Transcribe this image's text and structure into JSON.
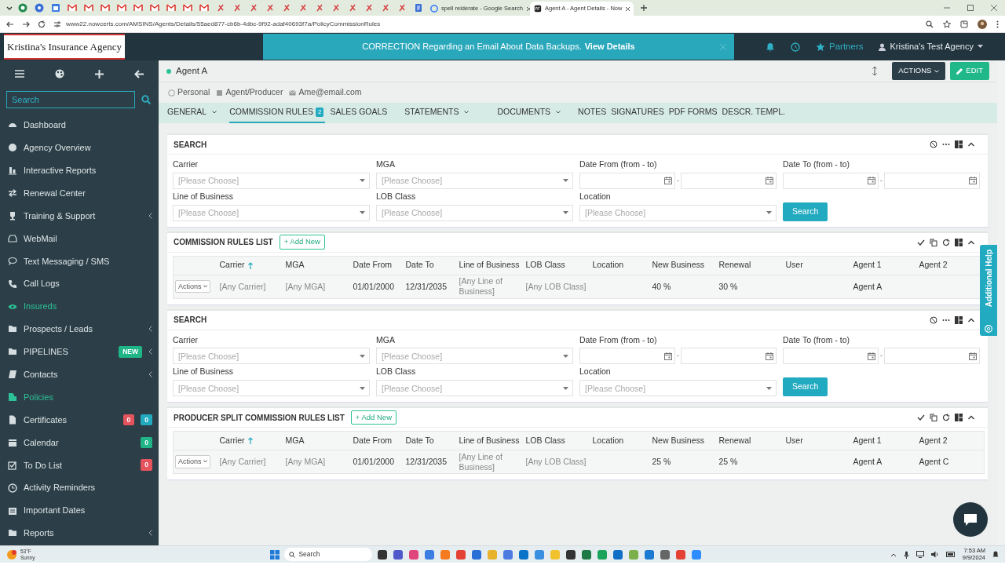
{
  "browser": {
    "tabs": [
      {
        "kind": "icon",
        "selected": false
      },
      {
        "kind": "icon",
        "selected": false
      },
      {
        "kind": "icon",
        "selected": false
      },
      {
        "kind": "icon",
        "selected": false
      },
      {
        "kind": "icon",
        "selected": false
      },
      {
        "kind": "icon",
        "selected": false
      },
      {
        "kind": "icon",
        "selected": false
      },
      {
        "kind": "icon",
        "selected": false
      },
      {
        "kind": "icon",
        "selected": false
      },
      {
        "kind": "icon",
        "selected": false
      },
      {
        "kind": "icon",
        "selected": false
      },
      {
        "kind": "icon",
        "selected": false
      },
      {
        "kind": "icon",
        "selected": false
      },
      {
        "kind": "icon",
        "selected": false
      },
      {
        "kind": "icon",
        "selected": false
      },
      {
        "kind": "icon",
        "selected": false
      },
      {
        "kind": "icon",
        "selected": false
      },
      {
        "kind": "icon",
        "selected": false
      },
      {
        "kind": "icon",
        "selected": false
      },
      {
        "kind": "icon",
        "selected": false
      },
      {
        "kind": "icon",
        "selected": false
      },
      {
        "kind": "icon",
        "selected": false
      },
      {
        "kind": "icon",
        "selected": false
      },
      {
        "kind": "icon",
        "selected": false
      },
      {
        "kind": "icon",
        "selected": false
      },
      {
        "kind": "page",
        "label": "spell reiderate - Google Search",
        "selected": false
      },
      {
        "kind": "page",
        "label": "Agent A - Agent Details - Now",
        "selected": true
      }
    ],
    "url": "www22.nowcerts.com/AMSINS/Agents/Details/55aed877-cb6b-4dbc-9f92-adaf40693f7a/PolicyCommissionRules"
  },
  "logo": "Kristina's Insurance Agency",
  "notice": {
    "text": "CORRECTION Regarding an Email About Data Backups.",
    "link": "View Details"
  },
  "topbar": {
    "partners": "Partners",
    "account": "Kristina's Test Agency"
  },
  "sidebar": {
    "search": {
      "placeholder": "Search"
    },
    "items": [
      {
        "label": "Dashboard",
        "highlighted": false,
        "submenu": false
      },
      {
        "label": "Agency Overview",
        "highlighted": false,
        "submenu": false
      },
      {
        "label": "Interactive Reports",
        "highlighted": false,
        "submenu": false
      },
      {
        "label": "Renewal Center",
        "highlighted": false,
        "submenu": false
      },
      {
        "label": "Training & Support",
        "highlighted": false,
        "submenu": true
      },
      {
        "label": "WebMail",
        "highlighted": false,
        "submenu": false
      },
      {
        "label": "Text Messaging / SMS",
        "highlighted": false,
        "submenu": false
      },
      {
        "label": "Call Logs",
        "highlighted": false,
        "submenu": false
      },
      {
        "label": "Insureds",
        "highlighted": true,
        "submenu": false
      },
      {
        "label": "Prospects / Leads",
        "highlighted": false,
        "submenu": true
      },
      {
        "label": "PIPELINES",
        "highlighted": false,
        "submenu": true,
        "badges": [
          {
            "text": "NEW",
            "color": "#1fb587"
          }
        ]
      },
      {
        "label": "Contacts",
        "highlighted": false,
        "submenu": true
      },
      {
        "label": "Policies",
        "highlighted": true,
        "submenu": false
      },
      {
        "label": "Certificates",
        "highlighted": false,
        "submenu": false,
        "badges": [
          {
            "text": "0",
            "color": "#e5535c"
          },
          {
            "text": "0",
            "color": "#21aac0"
          }
        ]
      },
      {
        "label": "Calendar",
        "highlighted": false,
        "submenu": false,
        "badges": [
          {
            "text": "0",
            "color": "#1fb587"
          }
        ]
      },
      {
        "label": "To Do List",
        "highlighted": false,
        "submenu": false,
        "badges": [
          {
            "text": "0",
            "color": "#e5535c"
          }
        ]
      },
      {
        "label": "Activity Reminders",
        "highlighted": false,
        "submenu": false
      },
      {
        "label": "Important Dates",
        "highlighted": false,
        "submenu": false
      },
      {
        "label": "Reports",
        "highlighted": false,
        "submenu": true
      }
    ]
  },
  "agent": {
    "name": "Agent A",
    "actions": "ACTIONS",
    "edit": "EDIT",
    "info": [
      "Personal",
      "Agent/Producer",
      "Ame@email.com"
    ]
  },
  "tabs": [
    {
      "label": "GENERAL",
      "dropdown": true,
      "selected": false
    },
    {
      "label": "COMMISSION RULES",
      "badge": "2",
      "dropdown": false,
      "selected": true
    },
    {
      "label": "SALES GOALS",
      "dropdown": false,
      "selected": false
    },
    {
      "label": "STATEMENTS",
      "dropdown": true,
      "selected": false
    },
    {
      "label": "DOCUMENTS",
      "dropdown": true,
      "selected": false
    },
    {
      "label": "NOTES",
      "dropdown": false,
      "selected": false
    },
    {
      "label": "SIGNATURES",
      "dropdown": false,
      "selected": false
    },
    {
      "label": "PDF FORMS",
      "dropdown": false,
      "selected": false
    },
    {
      "label": "DESCR. TEMPL.",
      "dropdown": false,
      "selected": false
    }
  ],
  "sections": [
    {
      "kind": "search",
      "title": "SEARCH",
      "button": "Search",
      "fields": [
        {
          "label": "Carrier",
          "kind": "select",
          "placeholder": "[Please Choose]"
        },
        {
          "label": "MGA",
          "kind": "select",
          "placeholder": "[Please Choose]"
        },
        {
          "label": "Date From (from - to)",
          "kind": "daterange",
          "separator": "-"
        },
        {
          "label": "Date To (from - to)",
          "kind": "daterange",
          "separator": "-"
        },
        {
          "label": "Line of Business",
          "kind": "select",
          "placeholder": "[Please Choose]"
        },
        {
          "label": "LOB Class",
          "kind": "select",
          "placeholder": "[Please Choose]"
        },
        {
          "label": "Location",
          "kind": "select",
          "placeholder": "[Please Choose]"
        }
      ]
    },
    {
      "kind": "list",
      "title": "COMMISSION RULES LIST",
      "add": "+ Add New",
      "columns": [
        {
          "label": "Carrier",
          "sorted": true
        },
        {
          "label": "MGA",
          "sorted": false
        },
        {
          "label": "Date From",
          "sorted": false
        },
        {
          "label": "Date To",
          "sorted": false
        },
        {
          "label": "Line of Business",
          "sorted": false
        },
        {
          "label": "LOB Class",
          "sorted": false
        },
        {
          "label": "Location",
          "sorted": false
        },
        {
          "label": "New Business",
          "sorted": false
        },
        {
          "label": "Renewal",
          "sorted": false
        },
        {
          "label": "User",
          "sorted": false
        },
        {
          "label": "Agent 1",
          "sorted": false
        },
        {
          "label": "Agent 2",
          "sorted": false
        }
      ],
      "rows": [
        {
          "actions": "Actions",
          "cells": [
            {
              "text": "[Any Carrier]",
              "dim": true
            },
            {
              "text": "[Any MGA]",
              "dim": true
            },
            {
              "text": "01/01/2000",
              "dim": false
            },
            {
              "text": "12/31/2035",
              "dim": false
            },
            {
              "text": "[Any Line of Business]",
              "dim": true
            },
            {
              "text": "[Any LOB Class]",
              "dim": true
            },
            null,
            {
              "text": "40 %",
              "dim": false
            },
            {
              "text": "30 %",
              "dim": false
            },
            null,
            {
              "text": "Agent A",
              "dim": false
            },
            null
          ]
        }
      ]
    },
    {
      "kind": "search",
      "title": "SEARCH",
      "button": "Search",
      "fields": [
        {
          "label": "Carrier",
          "kind": "select",
          "placeholder": "[Please Choose]"
        },
        {
          "label": "MGA",
          "kind": "select",
          "placeholder": "[Please Choose]"
        },
        {
          "label": "Date From (from - to)",
          "kind": "daterange",
          "separator": "-"
        },
        {
          "label": "Date To (from - to)",
          "kind": "daterange",
          "separator": "-"
        },
        {
          "label": "Line of Business",
          "kind": "select",
          "placeholder": "[Please Choose]"
        },
        {
          "label": "LOB Class",
          "kind": "select",
          "placeholder": "[Please Choose]"
        },
        {
          "label": "Location",
          "kind": "select",
          "placeholder": "[Please Choose]"
        }
      ]
    },
    {
      "kind": "list",
      "title": "PRODUCER SPLIT COMMISSION RULES LIST",
      "add": "+ Add New",
      "columns": [
        {
          "label": "Carrier",
          "sorted": true
        },
        {
          "label": "MGA",
          "sorted": false
        },
        {
          "label": "Date From",
          "sorted": false
        },
        {
          "label": "Date To",
          "sorted": false
        },
        {
          "label": "Line of Business",
          "sorted": false
        },
        {
          "label": "LOB Class",
          "sorted": false
        },
        {
          "label": "Location",
          "sorted": false
        },
        {
          "label": "New Business",
          "sorted": false
        },
        {
          "label": "Renewal",
          "sorted": false
        },
        {
          "label": "User",
          "sorted": false
        },
        {
          "label": "Agent 1",
          "sorted": false
        },
        {
          "label": "Agent 2",
          "sorted": false
        }
      ],
      "rows": [
        {
          "actions": "Actions",
          "cells": [
            {
              "text": "[Any Carrier]",
              "dim": true
            },
            {
              "text": "[Any MGA]",
              "dim": true
            },
            {
              "text": "01/01/2000",
              "dim": false
            },
            {
              "text": "12/31/2035",
              "dim": false
            },
            {
              "text": "[Any Line of Business]",
              "dim": true
            },
            {
              "text": "[Any LOB Class]",
              "dim": true
            },
            null,
            {
              "text": "25 %",
              "dim": false
            },
            {
              "text": "25 %",
              "dim": false
            },
            null,
            {
              "text": "Agent A",
              "dim": false
            },
            {
              "text": "Agent C",
              "dim": false
            }
          ]
        }
      ]
    }
  ],
  "help_tab": "Additional Help",
  "taskbar": {
    "temperature": "53°F",
    "weather": "Sunny",
    "search": "Search",
    "time": "7:53 AM",
    "date": "9/9/2024"
  }
}
